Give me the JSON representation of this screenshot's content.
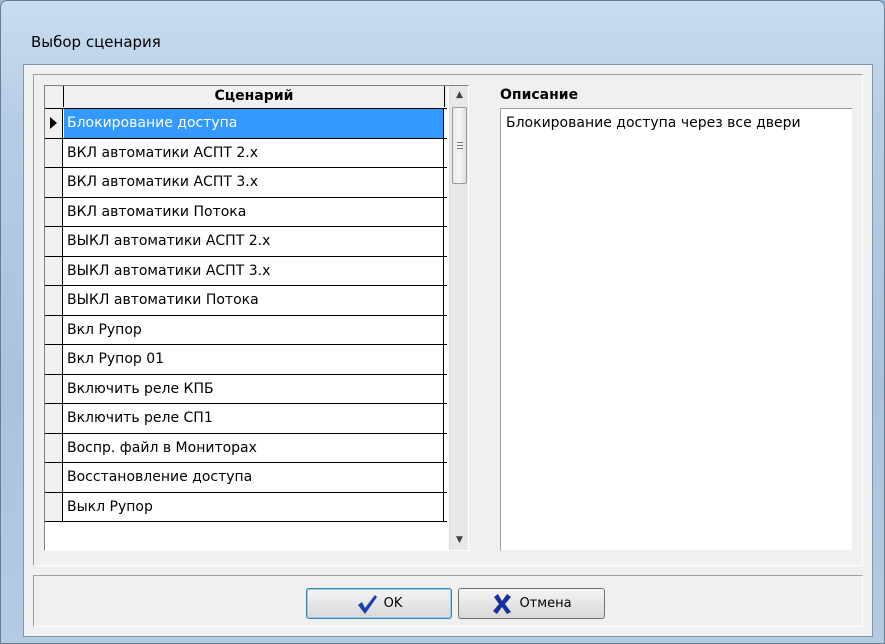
{
  "window": {
    "title": "Выбор сценария"
  },
  "grid": {
    "column_header": "Сценарий",
    "rows": [
      "Блокирование доступа",
      "ВКЛ автоматики АСПТ 2.х",
      "ВКЛ автоматики АСПТ 3.х",
      "ВКЛ автоматики Потока",
      "ВЫКЛ автоматики АСПТ 2.х",
      "ВЫКЛ автоматики АСПТ 3.х",
      "ВЫКЛ автоматики Потока",
      "Вкл Рупор",
      "Вкл Рупор 01",
      "Включить реле КПБ",
      "Включить реле СП1",
      "Воспр. файл в Мониторах",
      "Восстановление доступа",
      "Выкл Рупор"
    ],
    "selected_index": 0,
    "scroll_up_icon": "arrow-up-icon",
    "scroll_down_icon": "arrow-down-icon"
  },
  "description": {
    "label": "Описание",
    "text": "Блокирование доступа через все двери"
  },
  "buttons": {
    "ok_label": "OK",
    "ok_icon": "checkmark-icon",
    "cancel_label": "Отмена",
    "cancel_icon": "cross-icon"
  },
  "colors": {
    "selection": "#3399ff",
    "ok_icon": "#1a3fb0",
    "cancel_icon": "#1a2f9a"
  }
}
